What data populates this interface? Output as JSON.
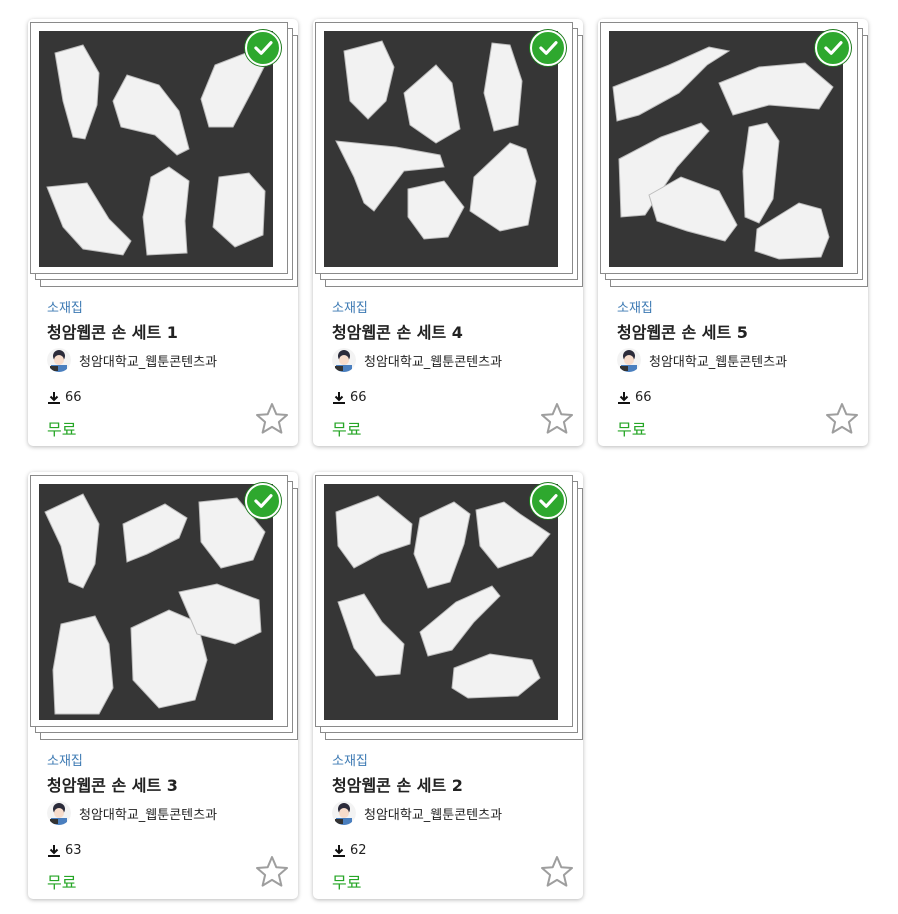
{
  "colors": {
    "category": "#3d7ab3",
    "price": "#26a626",
    "check_badge": "#2ea82e",
    "art_background": "#363636"
  },
  "cards": [
    {
      "category": "소재집",
      "title": "청암웹콘 손 세트 1",
      "author": "청암대학교_웹툰콘텐츠과",
      "downloads": "66",
      "price": "무료",
      "selected": true,
      "favorite_icon": "star-outline-icon"
    },
    {
      "category": "소재집",
      "title": "청암웹콘 손 세트 4",
      "author": "청암대학교_웹툰콘텐츠과",
      "downloads": "66",
      "price": "무료",
      "selected": true,
      "favorite_icon": "star-outline-icon"
    },
    {
      "category": "소재집",
      "title": "청암웹콘 손 세트 5",
      "author": "청암대학교_웹툰콘텐츠과",
      "downloads": "66",
      "price": "무료",
      "selected": true,
      "favorite_icon": "star-outline-icon"
    },
    {
      "category": "소재집",
      "title": "청암웹콘 손 세트 3",
      "author": "청암대학교_웹툰콘텐츠과",
      "downloads": "63",
      "price": "무료",
      "selected": true,
      "favorite_icon": "star-outline-icon"
    },
    {
      "category": "소재집",
      "title": "청암웹콘 손 세트 2",
      "author": "청암대학교_웹툰콘텐츠과",
      "downloads": "62",
      "price": "무료",
      "selected": true,
      "favorite_icon": "star-outline-icon"
    }
  ]
}
